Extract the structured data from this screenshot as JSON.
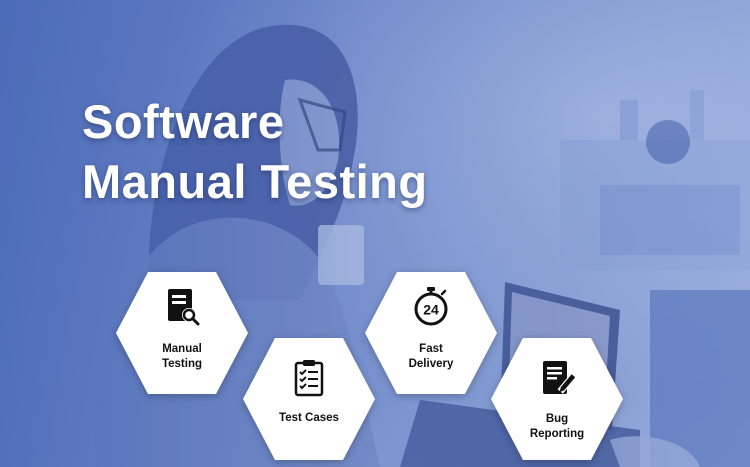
{
  "title": {
    "line1": "Software",
    "line2": "Manual Testing"
  },
  "hexagons": [
    {
      "label": "Manual\nTesting",
      "icon": "document-search-icon"
    },
    {
      "label": "Test Cases",
      "icon": "clipboard-checklist-icon"
    },
    {
      "label": "Fast\nDelivery",
      "icon": "stopwatch-24-icon"
    },
    {
      "label": "Bug\nReporting",
      "icon": "document-pencil-icon"
    }
  ],
  "stopwatch_text": "24",
  "colors": {
    "overlay": "#5b78c4",
    "hexagon_fill": "#ffffff",
    "icon": "#111111",
    "title": "#ffffff"
  }
}
